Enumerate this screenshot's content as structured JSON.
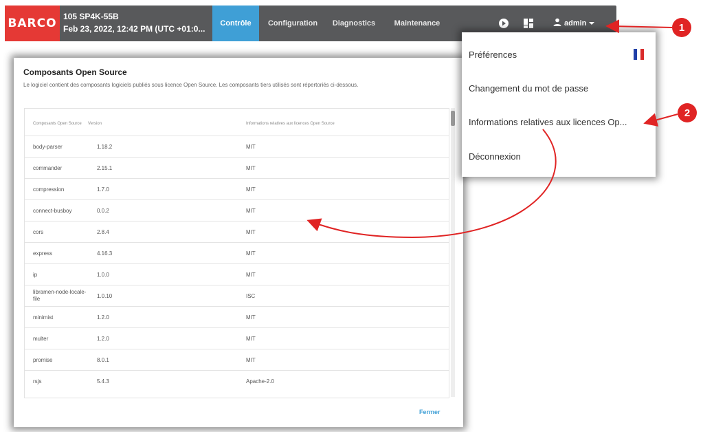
{
  "header": {
    "logo": "BARCO",
    "projector_name": "105 SP4K-55B",
    "datetime": "Feb 23, 2022, 12:42 PM (UTC +01:0...",
    "tabs": [
      {
        "label": "Contrôle",
        "active": true
      },
      {
        "label": "Configuration",
        "active": false
      },
      {
        "label": "Diagnostics",
        "active": false
      },
      {
        "label": "Maintenance",
        "active": false
      }
    ],
    "user_label": "admin"
  },
  "dialog": {
    "title": "Composants Open Source",
    "description": "Le logiciel contient des composants logiciels publiés sous licence Open Source. Les composants tiers utilisés sont répertoriés ci-dessous.",
    "columns": [
      "Composants Open Source",
      "Version",
      "Informations relatives aux licences Open Source"
    ],
    "rows": [
      {
        "name": "body-parser",
        "version": "1.18.2",
        "license": "MIT"
      },
      {
        "name": "commander",
        "version": "2.15.1",
        "license": "MIT"
      },
      {
        "name": "compression",
        "version": "1.7.0",
        "license": "MIT"
      },
      {
        "name": "connect-busboy",
        "version": "0.0.2",
        "license": "MIT"
      },
      {
        "name": "cors",
        "version": "2.8.4",
        "license": "MIT"
      },
      {
        "name": "express",
        "version": "4.16.3",
        "license": "MIT"
      },
      {
        "name": "ip",
        "version": "1.0.0",
        "license": "MIT"
      },
      {
        "name": "libramen-node-locale-file",
        "version": "1.0.10",
        "license": "ISC"
      },
      {
        "name": "minimist",
        "version": "1.2.0",
        "license": "MIT"
      },
      {
        "name": "multer",
        "version": "1.2.0",
        "license": "MIT"
      },
      {
        "name": "promise",
        "version": "8.0.1",
        "license": "MIT"
      },
      {
        "name": "rsjs",
        "version": "5.4.3",
        "license": "Apache-2.0"
      }
    ],
    "close_label": "Fermer"
  },
  "menu": {
    "items": [
      {
        "label": "Préférences"
      },
      {
        "label": "Changement du mot de passe"
      },
      {
        "label": "Informations relatives aux licences Op..."
      },
      {
        "label": "Déconnexion"
      }
    ]
  },
  "annotations": {
    "badge1": "1",
    "badge2": "2"
  },
  "colors": {
    "accent": "#3f9fd6",
    "brand": "#e53935",
    "topbar": "#58595b",
    "annotation": "#e02424"
  },
  "icons": {
    "play": "play-circle-icon",
    "layout": "grid-layout-icon",
    "user": "user-icon",
    "caret": "caret-down-icon",
    "flag": "french-flag-icon"
  }
}
